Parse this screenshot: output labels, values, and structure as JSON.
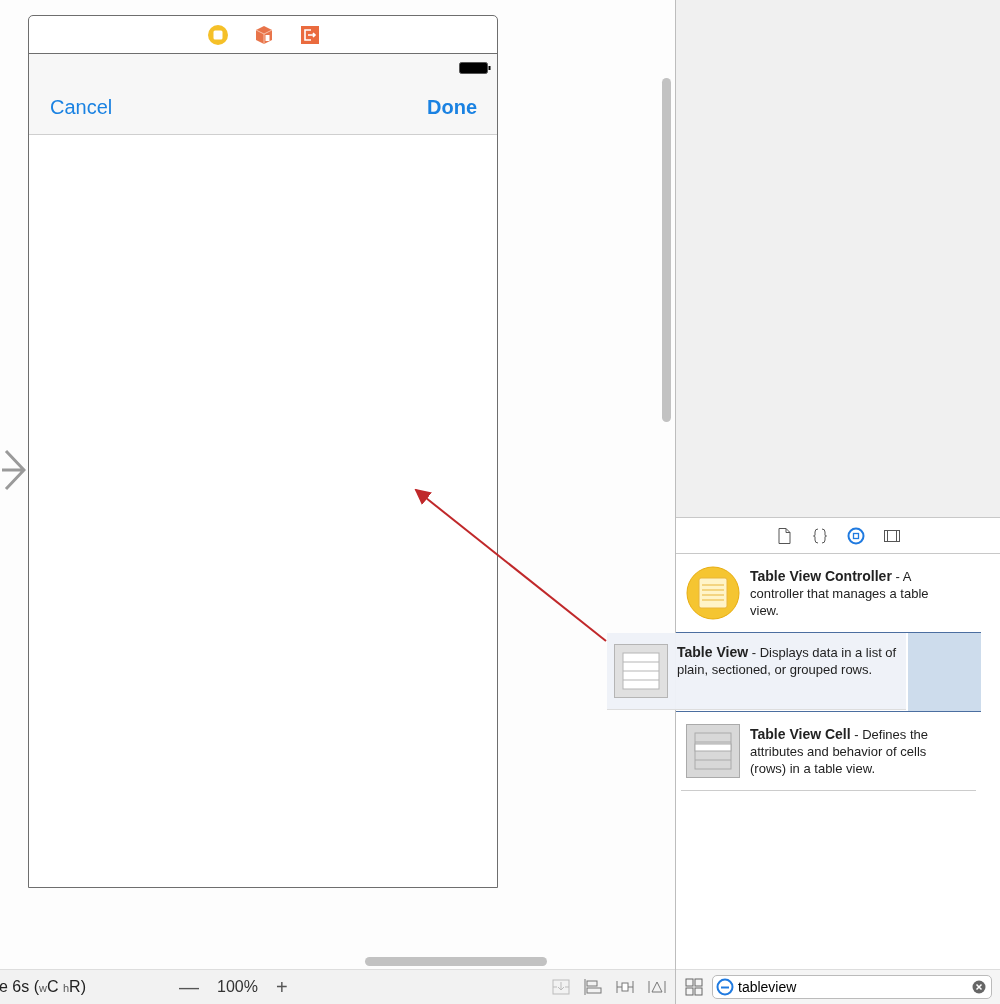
{
  "canvas": {
    "nav_bar": {
      "left_button": "Cancel",
      "right_button": "Done"
    }
  },
  "bottom_bar": {
    "view_as": "e 6s ($_{w}$C $_{h}$R)",
    "zoom_out": "—",
    "zoom_level": "100%",
    "zoom_in": "+"
  },
  "library": {
    "tabs": [
      {
        "kind": "file",
        "selected": false
      },
      {
        "kind": "braces",
        "selected": false
      },
      {
        "kind": "object",
        "selected": true
      },
      {
        "kind": "media",
        "selected": false
      }
    ],
    "items": [
      {
        "kind": "controller",
        "text": "**Table View Controller** - A controller that manages a table view.",
        "selected": false
      },
      {
        "kind": "table",
        "selected": true
      },
      {
        "kind": "cell",
        "text": "**Table View Cell** - Defines the attributes and behavior of cells (rows) in a table view.",
        "selected": false
      }
    ],
    "search": {
      "value": "tableview"
    }
  },
  "drag_preview": {
    "text": "**Table View** - Displays data in a list of plain, sectioned, or grouped rows."
  }
}
